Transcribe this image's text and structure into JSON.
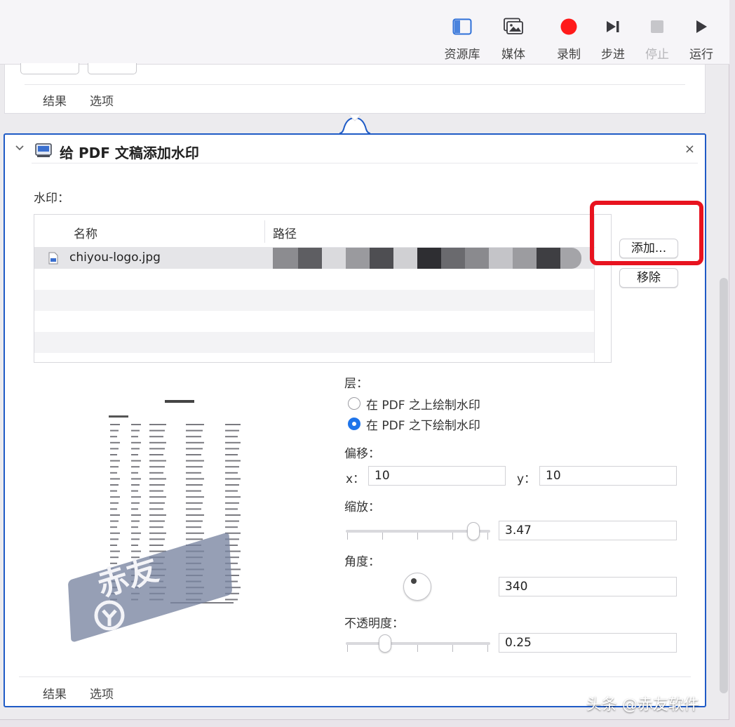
{
  "toolbar": {
    "items": [
      {
        "label": "资源库",
        "icon": "library-icon",
        "enabled": true
      },
      {
        "label": "媒体",
        "icon": "media-icon",
        "enabled": true
      },
      {
        "label": "录制",
        "icon": "record-icon",
        "enabled": true
      },
      {
        "label": "步进",
        "icon": "step-icon",
        "enabled": true
      },
      {
        "label": "停止",
        "icon": "stop-icon",
        "enabled": false
      },
      {
        "label": "运行",
        "icon": "run-icon",
        "enabled": true
      }
    ],
    "colors": {
      "record": "#ff1a1a",
      "icon_blue": "#2d6fd8",
      "icon_dark": "#3a3a3f"
    }
  },
  "upper_panel": {
    "tabs": [
      "结果",
      "选项"
    ]
  },
  "action": {
    "title": "给 PDF 文稿添加水印",
    "close": "×",
    "watermark_label": "水印：",
    "table": {
      "columns": [
        "名称",
        "路径"
      ],
      "rows": [
        {
          "name": "chiyou-logo.jpg"
        }
      ]
    },
    "add_button": "添加...",
    "remove_button": "移除",
    "layer_label": "层：",
    "layer_options": [
      "在 PDF 之上绘制水印",
      "在 PDF 之下绘制水印"
    ],
    "layer_selected": 1,
    "offset_label": "偏移：",
    "offset": {
      "x_label": "x：",
      "x": "10",
      "y_label": "y：",
      "y": "10"
    },
    "scale_label": "缩放：",
    "scale_value": "3.47",
    "scale_fraction": 0.92,
    "angle_label": "角度：",
    "angle_value": "340",
    "opacity_label": "不透明度：",
    "opacity_value": "0.25",
    "opacity_fraction": 0.25,
    "bottom_tabs": [
      "结果",
      "选项"
    ],
    "preview_watermark_text": "赤友",
    "accent": "#1f5bc6",
    "highlight": "#e8131f"
  },
  "credit": "头条 @赤友软件"
}
